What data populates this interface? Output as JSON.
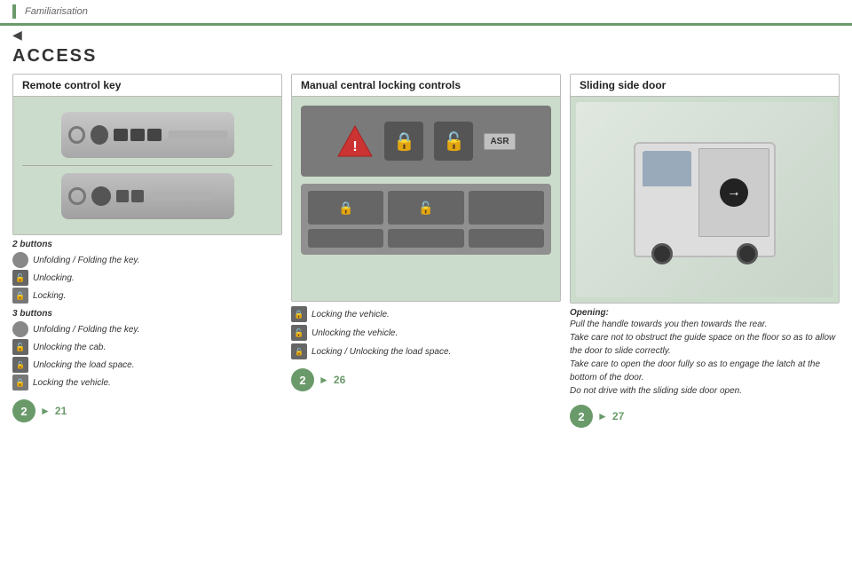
{
  "breadcrumb": "Familiarisation",
  "section_title": "ACCESS",
  "col1": {
    "card_title": "Remote control key",
    "buttons_2_title": "2 buttons",
    "buttons_2_items": [
      {
        "label": "Unfolding / Folding the key."
      },
      {
        "label": "Unlocking."
      },
      {
        "label": "Locking."
      }
    ],
    "buttons_3_title": "3 buttons",
    "buttons_3_items": [
      {
        "label": "Unfolding / Folding the key."
      },
      {
        "label": "Unlocking the cab."
      },
      {
        "label": "Unlocking the load space."
      },
      {
        "label": "Locking the vehicle."
      }
    ],
    "nav_circle": "2",
    "nav_page": "21"
  },
  "col2": {
    "card_title": "Manual central locking controls",
    "legend_items": [
      {
        "label": "Locking the vehicle."
      },
      {
        "label": "Unlocking the vehicle."
      },
      {
        "label": "Locking / Unlocking the load space."
      }
    ],
    "nav_circle": "2",
    "nav_page": "26"
  },
  "col3": {
    "card_title": "Sliding side door",
    "opening_title": "Opening:",
    "opening_text": "Pull the handle towards you then towards the rear.",
    "opening_text2": "Take care not to obstruct the guide space on the floor so as to allow the door to slide correctly.",
    "opening_text3": "Take care to open the door fully so as to engage the latch at the bottom of the door.",
    "opening_text4": "Do not drive with the sliding side door open.",
    "nav_circle": "2",
    "nav_page": "27"
  }
}
